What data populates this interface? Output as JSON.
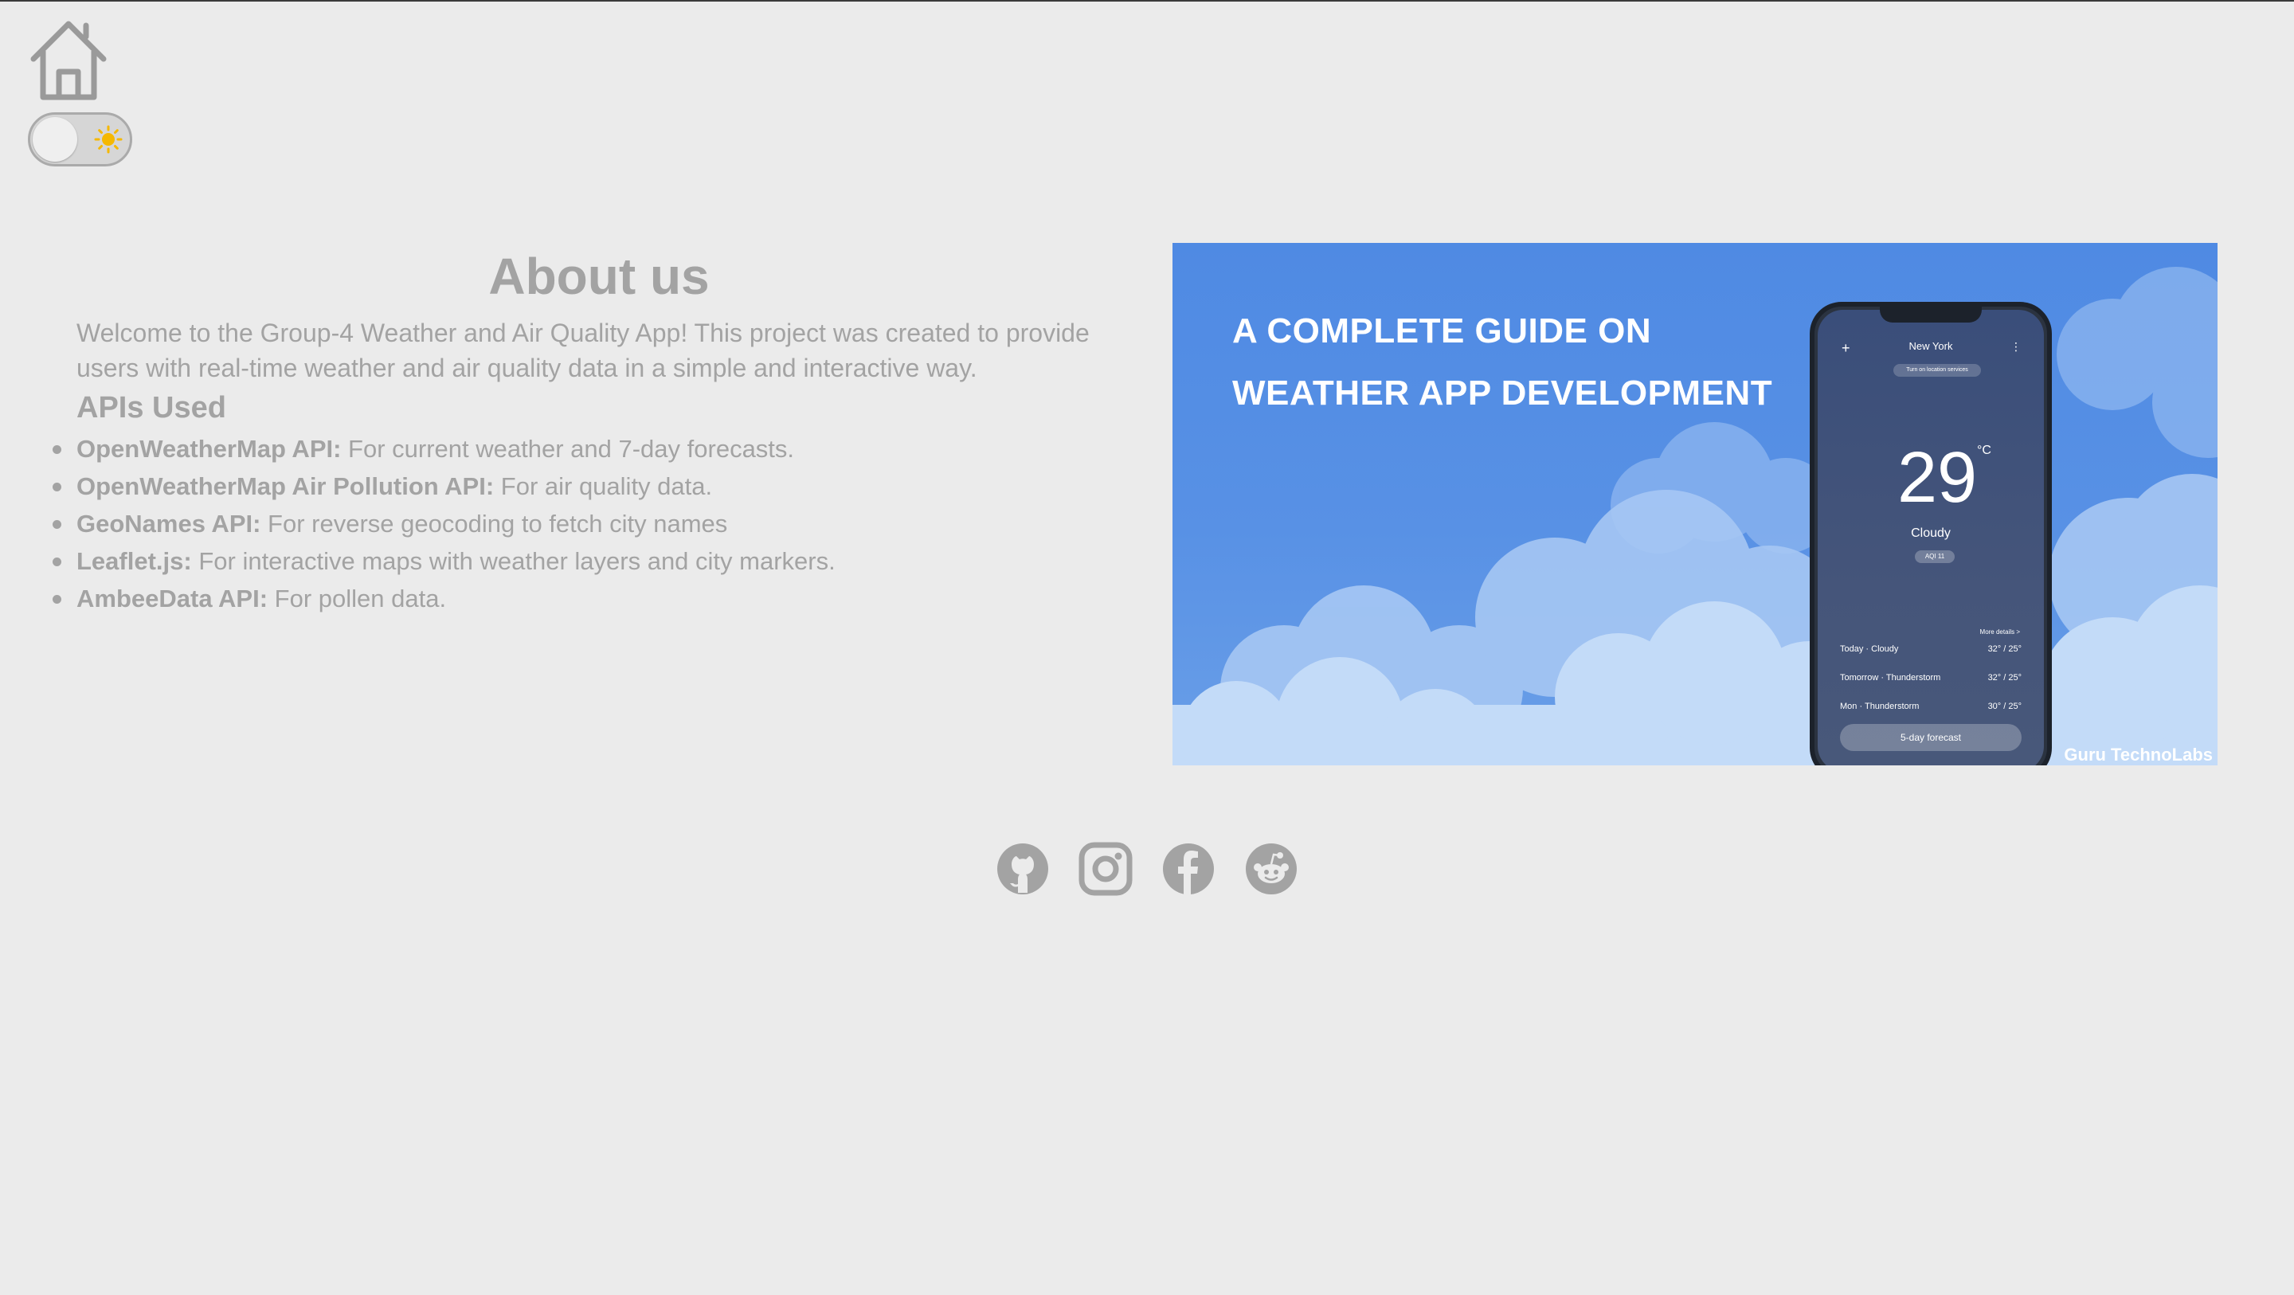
{
  "header": {
    "home_icon": "home-icon",
    "theme_toggle": {
      "state": "light",
      "icon": "sun-icon"
    }
  },
  "about": {
    "title": "About us",
    "intro": "Welcome to the Group-4 Weather and Air Quality App! This project was created to provide users with real-time weather and air quality data in a simple and interactive way.",
    "apis_heading": "APIs Used",
    "apis": [
      {
        "name": "OpenWeatherMap API:",
        "desc": " For current weather and 7-day forecasts."
      },
      {
        "name": "OpenWeatherMap Air Pollution API:",
        "desc": " For air quality data."
      },
      {
        "name": "GeoNames API:",
        "desc": " For reverse geocoding to fetch city names"
      },
      {
        "name": "Leaflet.js:",
        "desc": " For interactive maps with weather layers and city markers."
      },
      {
        "name": "AmbeeData API:",
        "desc": " For pollen data."
      }
    ]
  },
  "hero": {
    "title_line1": "A COMPLETE GUIDE ON",
    "title_line2": "WEATHER APP DEVELOPMENT",
    "credit": "Guru TechnoLabs",
    "phone": {
      "city": "New York",
      "location_pill": "Turn on location services",
      "temperature": "29",
      "unit": "°C",
      "condition": "Cloudy",
      "aqi": "AQI 11",
      "more_details": "More details >",
      "forecast": [
        {
          "day": "Today · Cloudy",
          "range": "32° / 25°"
        },
        {
          "day": "Tomorrow · Thunderstorm",
          "range": "32° / 25°"
        },
        {
          "day": "Mon · Thunderstorm",
          "range": "30° / 25°"
        }
      ],
      "forecast_button": "5-day forecast"
    }
  },
  "footer": {
    "socials": [
      {
        "name": "github-icon"
      },
      {
        "name": "instagram-icon"
      },
      {
        "name": "facebook-icon"
      },
      {
        "name": "reddit-icon"
      }
    ]
  },
  "colors": {
    "background": "#ebebeb",
    "text": "#a3a3a3",
    "hero_blue": "#4f8ae3",
    "sun": "#f5b800"
  }
}
